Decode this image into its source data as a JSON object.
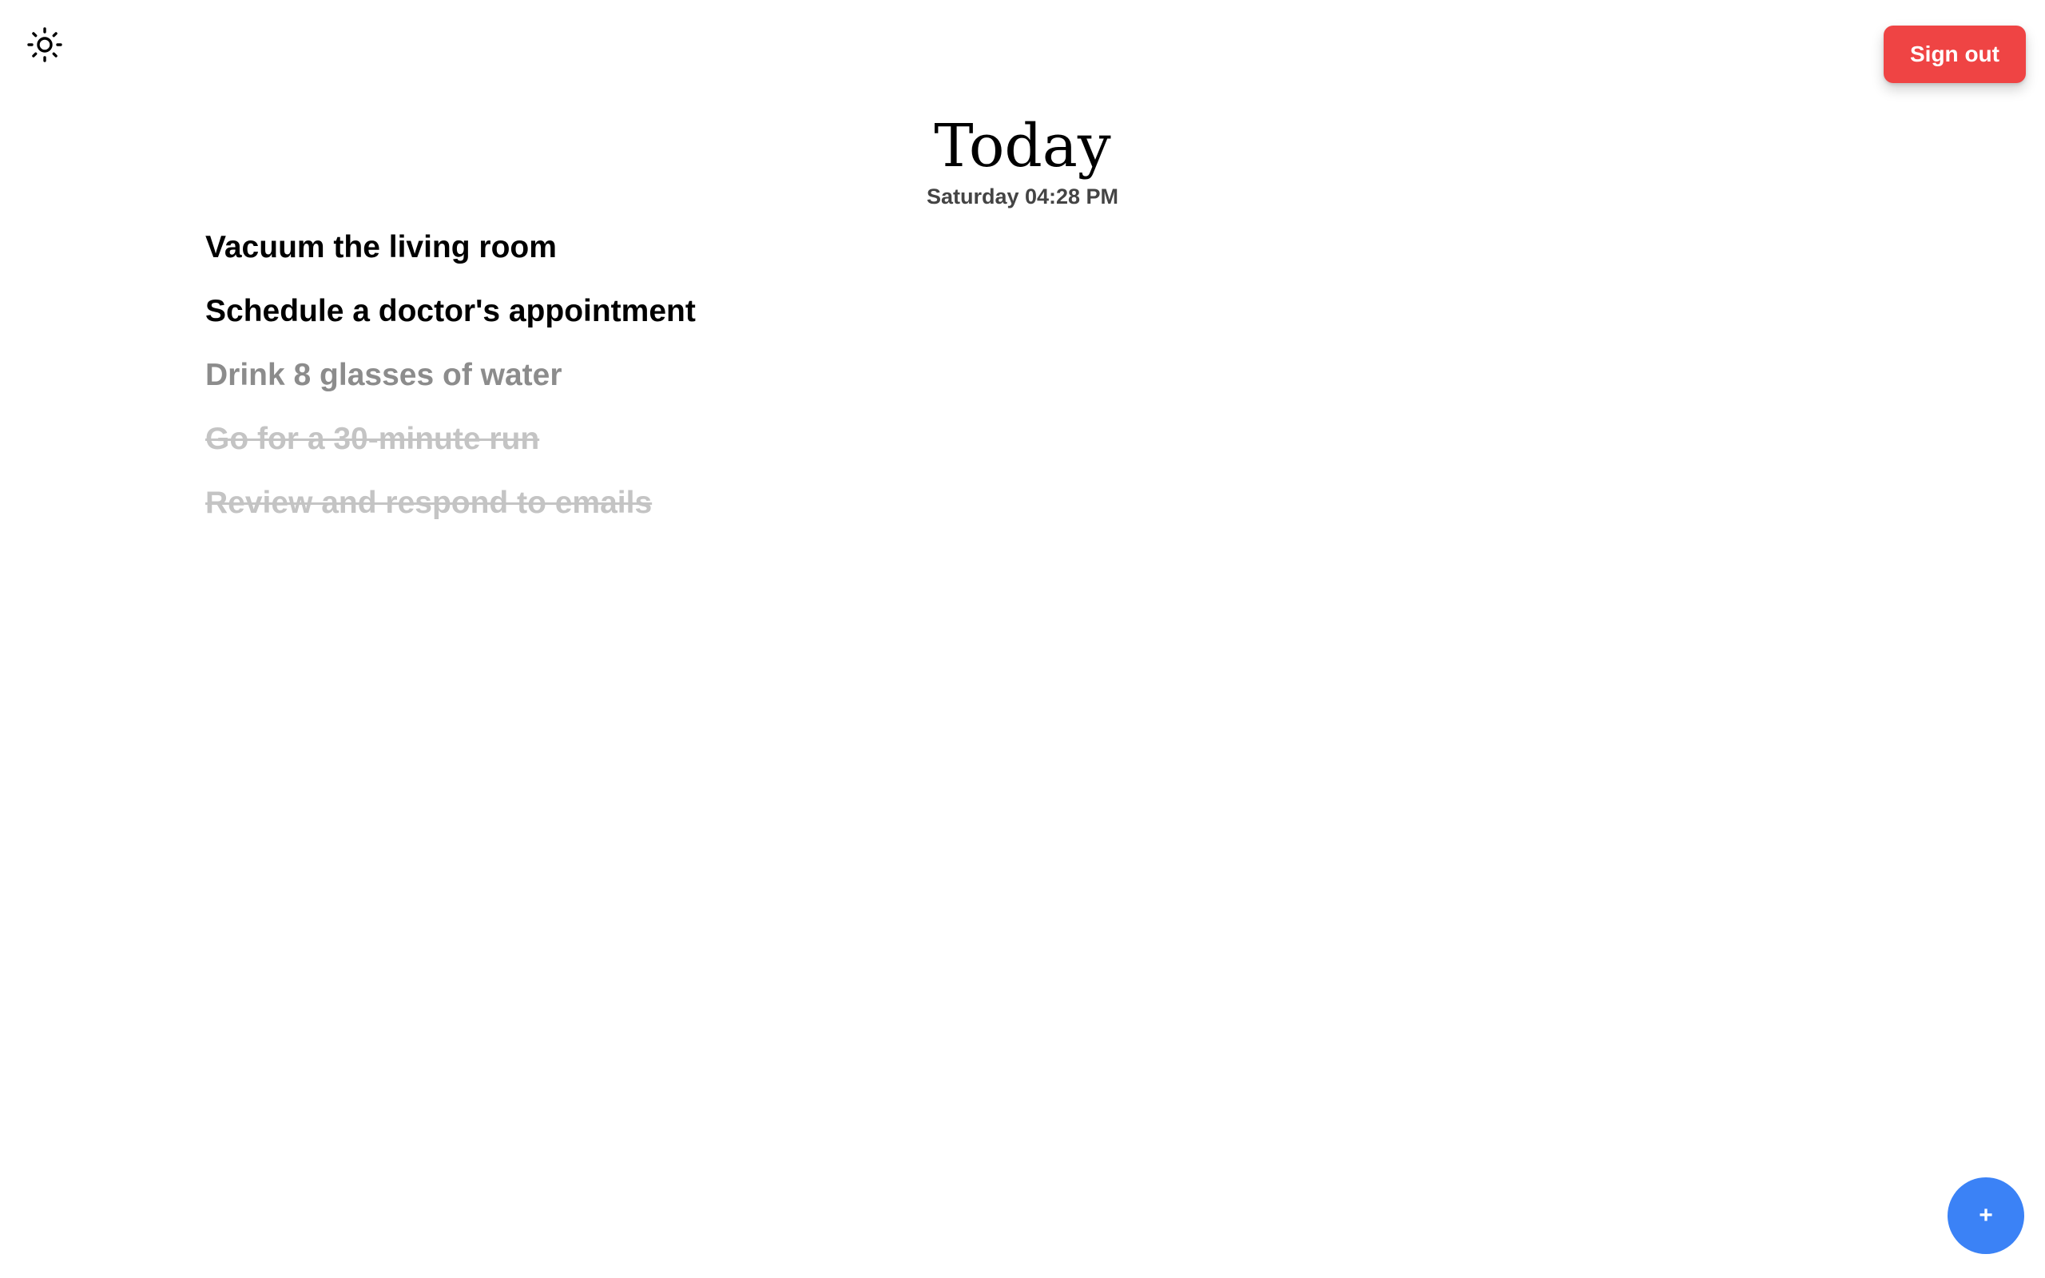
{
  "header": {
    "title": "Today",
    "subtitle": "Saturday 04:28 PM"
  },
  "toolbar": {
    "theme_icon": "sun-icon",
    "signout_label": "Sign out",
    "signout_color": "#ef4444"
  },
  "tasks": [
    {
      "text": "Vacuum the living room",
      "state": "pending"
    },
    {
      "text": "Schedule a doctor's appointment",
      "state": "pending"
    },
    {
      "text": "Drink 8 glasses of water",
      "state": "in-progress"
    },
    {
      "text": "Go for a 30-minute run",
      "state": "done"
    },
    {
      "text": "Review and respond to emails",
      "state": "done"
    }
  ],
  "fab": {
    "label": "+",
    "color": "#3b82f6"
  }
}
